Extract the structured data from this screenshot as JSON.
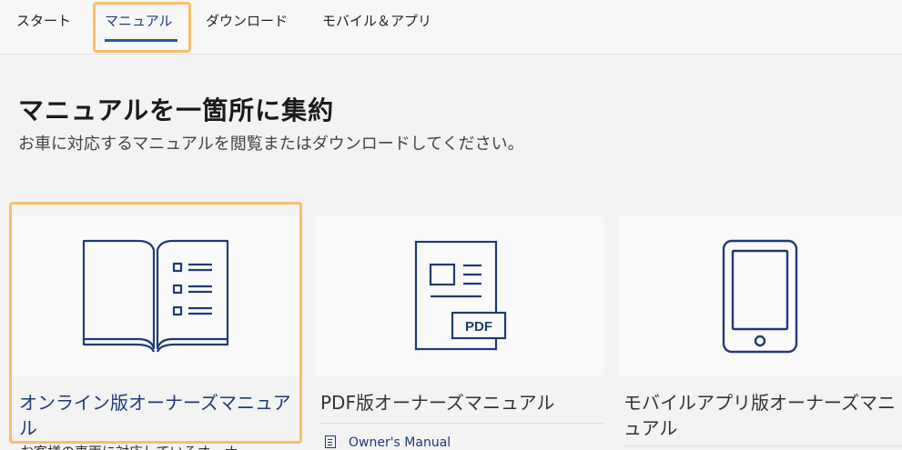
{
  "nav": {
    "items": [
      {
        "label": "スタート",
        "active": false
      },
      {
        "label": "マニュアル",
        "active": true
      },
      {
        "label": "ダウンロード",
        "active": false
      },
      {
        "label": "モバイル＆アプリ",
        "active": false
      }
    ]
  },
  "page": {
    "title": "マニュアルを一箇所に集約",
    "subtitle": "お車に対応するマニュアルを閲覧またはダウンロードしてください。"
  },
  "cards": [
    {
      "title": "オンライン版オーナーズマニュアル",
      "icon": "open-book-icon",
      "description": "お客様の車両に対応しているオーナ",
      "selected": true
    },
    {
      "title": "PDF版オーナーズマニュアル",
      "icon": "pdf-document-icon",
      "icon_label": "PDF",
      "sublink": "Owner's Manual",
      "selected": false
    },
    {
      "title": "モバイルアプリ版オーナーズマニュアル",
      "icon": "tablet-icon",
      "selected": false
    }
  ],
  "colors": {
    "accent_navy": "#1f3b73",
    "underline_blue": "#1f5fa8",
    "highlight": "#f6c06a",
    "background": "#f3f3f3"
  }
}
